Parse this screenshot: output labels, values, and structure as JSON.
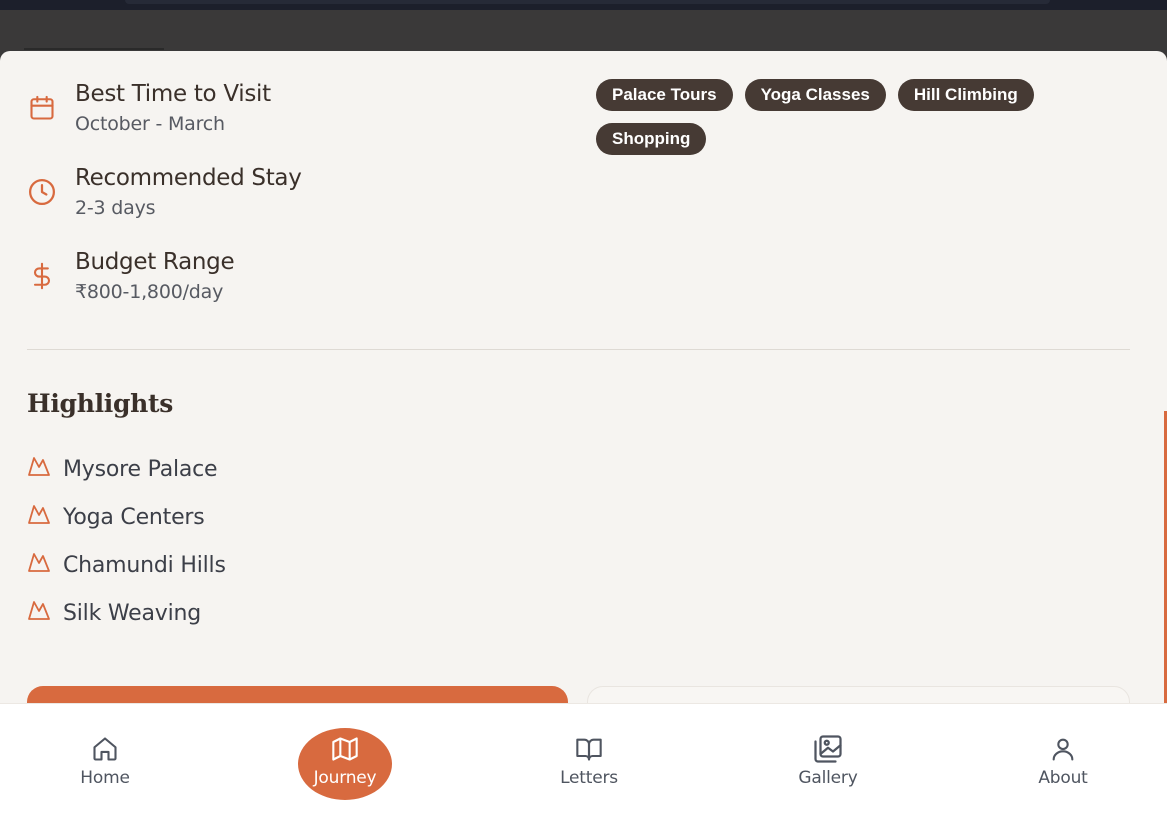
{
  "trip_info": [
    {
      "icon": "calendar-icon",
      "label": "Best Time to Visit",
      "value": "October - March"
    },
    {
      "icon": "clock-icon",
      "label": "Recommended Stay",
      "value": "2-3 days"
    },
    {
      "icon": "dollar-icon",
      "label": "Budget Range",
      "value": "₹800-1,800/day"
    }
  ],
  "activity_tags": [
    "Palace Tours",
    "Yoga Classes",
    "Hill Climbing",
    "Shopping"
  ],
  "highlights": {
    "title": "Highlights",
    "items": [
      "Mysore Palace",
      "Yoga Centers",
      "Chamundi Hills",
      "Silk Weaving"
    ],
    "icon": "mountain-icon"
  },
  "bottom_nav": {
    "active": "Journey",
    "items": [
      {
        "label": "Home",
        "icon": "home-icon"
      },
      {
        "label": "Journey",
        "icon": "map-icon"
      },
      {
        "label": "Letters",
        "icon": "book-icon"
      },
      {
        "label": "Gallery",
        "icon": "images-icon"
      },
      {
        "label": "About",
        "icon": "user-icon"
      }
    ]
  },
  "colors": {
    "accent": "#d86a3f",
    "tag_bg": "#463a34",
    "sheet_bg": "#f6f4f1",
    "text_dark": "#3a302a"
  }
}
